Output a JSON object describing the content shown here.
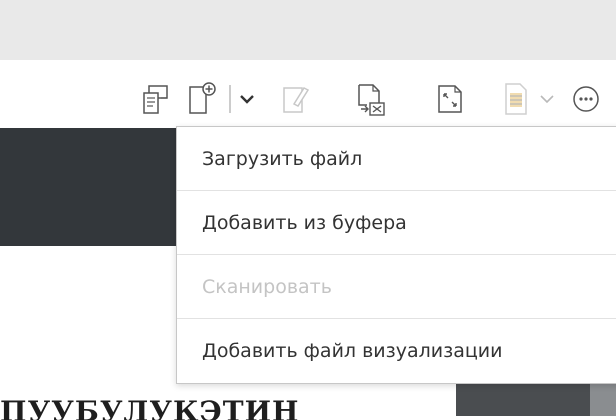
{
  "colors": {
    "topbar": "#e9e9e9",
    "dark_band": "#33373b",
    "icon_stroke": "#555555",
    "icon_disabled": "#c8c8c8",
    "menu_text": "#333333",
    "menu_text_disabled": "#c4c4c4"
  },
  "toolbar": {
    "icons": [
      "copy-document-icon",
      "add-document-icon",
      "dropdown-chevron-icon",
      "edit-document-icon",
      "remove-attachment-icon",
      "expand-icon",
      "document-text-icon",
      "dropdown-chevron-icon",
      "more-options-icon"
    ]
  },
  "menu": {
    "items": [
      {
        "label": "Загрузить файл",
        "enabled": true
      },
      {
        "label": "Добавить из буфера",
        "enabled": true
      },
      {
        "label": "Сканировать",
        "enabled": false
      },
      {
        "label": "Добавить файл визуализации",
        "enabled": true
      }
    ]
  },
  "document": {
    "heading": "ПУУБУЛУКЭТИН"
  }
}
